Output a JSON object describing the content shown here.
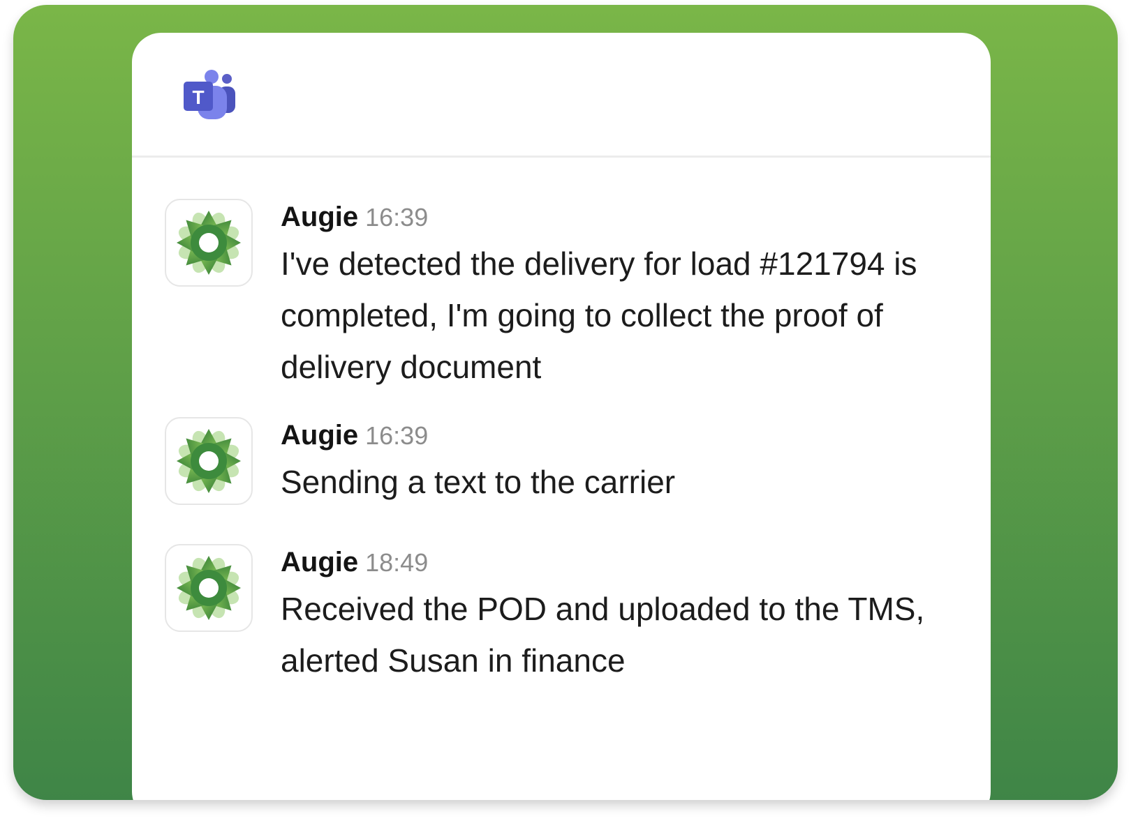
{
  "colors": {
    "background_top": "#7ab648",
    "background_bottom": "#3f8547",
    "teams_purple": "#5b5fc7",
    "avatar_green": "#3d8b3d"
  },
  "header": {
    "app_icon": "microsoft-teams-icon"
  },
  "messages": [
    {
      "author": "Augie",
      "time": "16:39",
      "avatar_icon": "augie-flower-icon",
      "text": "I've detected the delivery for load #121794 is completed, I'm going to collect the proof of delivery document"
    },
    {
      "author": "Augie",
      "time": "16:39",
      "avatar_icon": "augie-flower-icon",
      "text": "Sending a text to the carrier"
    },
    {
      "author": "Augie",
      "time": "18:49",
      "avatar_icon": "augie-flower-icon",
      "text": "Received the POD and uploaded to the TMS, alerted Susan in finance"
    }
  ]
}
